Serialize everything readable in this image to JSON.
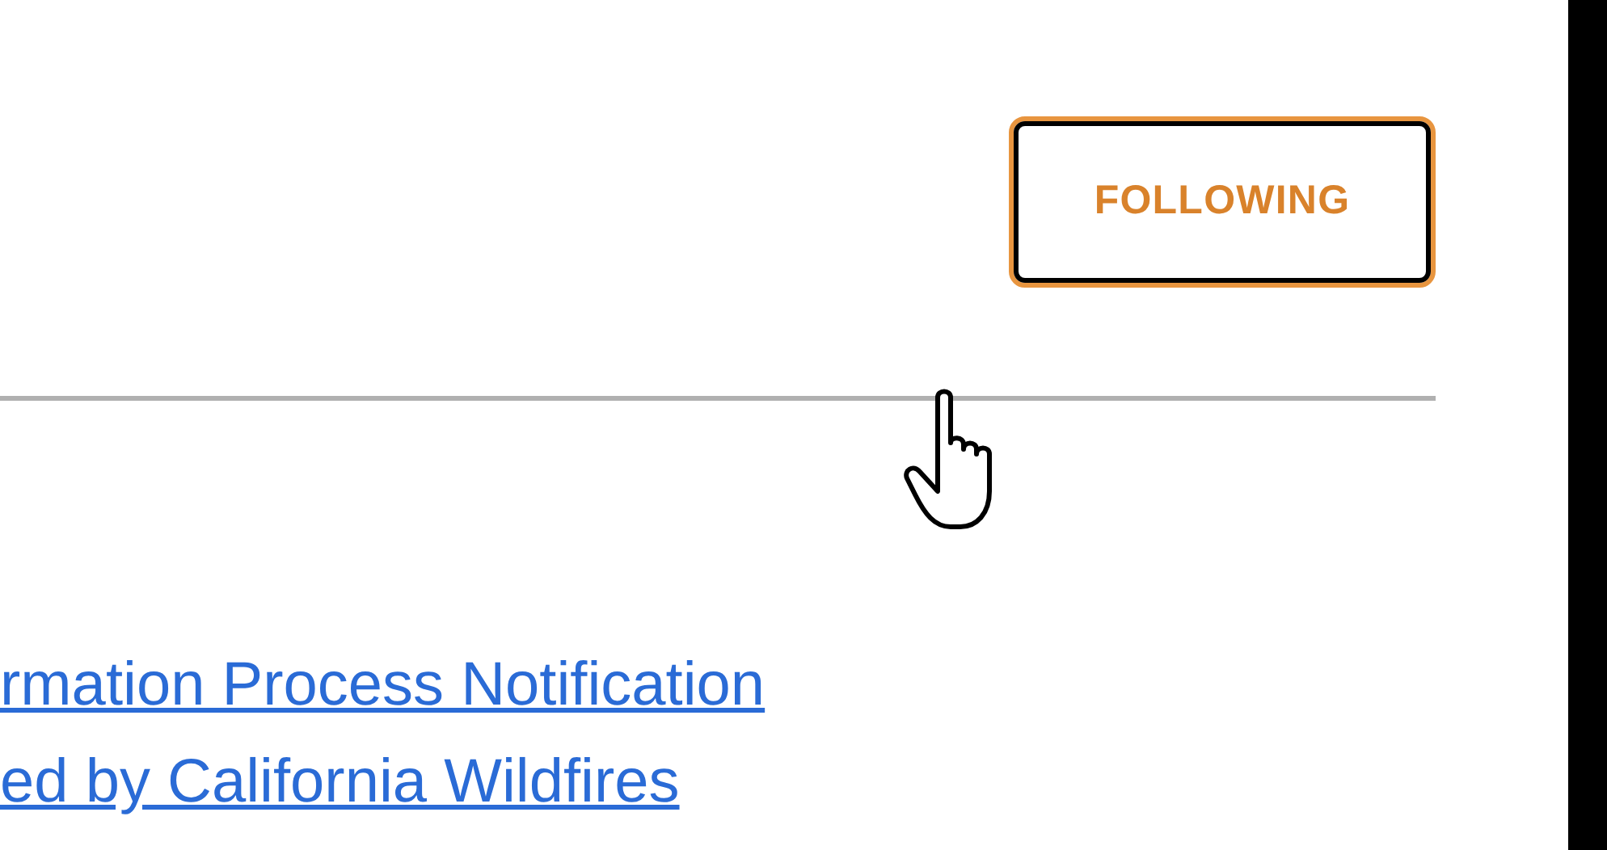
{
  "follow_button": {
    "label": "FOLLOWING",
    "selected": true
  },
  "links": [
    {
      "text": "rmation Process Notification"
    },
    {
      "text": "ed by California Wildfires"
    }
  ]
}
